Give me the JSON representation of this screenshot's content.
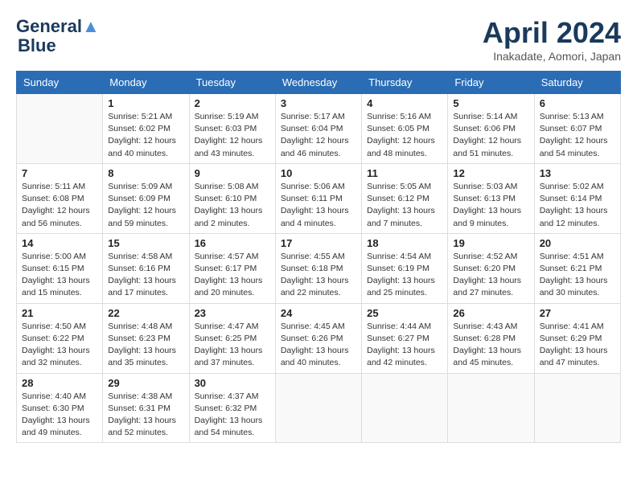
{
  "header": {
    "logo_line1": "General",
    "logo_line2": "Blue",
    "month_title": "April 2024",
    "location": "Inakadate, Aomori, Japan"
  },
  "days_of_week": [
    "Sunday",
    "Monday",
    "Tuesday",
    "Wednesday",
    "Thursday",
    "Friday",
    "Saturday"
  ],
  "weeks": [
    [
      {
        "day": "",
        "info": ""
      },
      {
        "day": "1",
        "info": "Sunrise: 5:21 AM\nSunset: 6:02 PM\nDaylight: 12 hours\nand 40 minutes."
      },
      {
        "day": "2",
        "info": "Sunrise: 5:19 AM\nSunset: 6:03 PM\nDaylight: 12 hours\nand 43 minutes."
      },
      {
        "day": "3",
        "info": "Sunrise: 5:17 AM\nSunset: 6:04 PM\nDaylight: 12 hours\nand 46 minutes."
      },
      {
        "day": "4",
        "info": "Sunrise: 5:16 AM\nSunset: 6:05 PM\nDaylight: 12 hours\nand 48 minutes."
      },
      {
        "day": "5",
        "info": "Sunrise: 5:14 AM\nSunset: 6:06 PM\nDaylight: 12 hours\nand 51 minutes."
      },
      {
        "day": "6",
        "info": "Sunrise: 5:13 AM\nSunset: 6:07 PM\nDaylight: 12 hours\nand 54 minutes."
      }
    ],
    [
      {
        "day": "7",
        "info": "Sunrise: 5:11 AM\nSunset: 6:08 PM\nDaylight: 12 hours\nand 56 minutes."
      },
      {
        "day": "8",
        "info": "Sunrise: 5:09 AM\nSunset: 6:09 PM\nDaylight: 12 hours\nand 59 minutes."
      },
      {
        "day": "9",
        "info": "Sunrise: 5:08 AM\nSunset: 6:10 PM\nDaylight: 13 hours\nand 2 minutes."
      },
      {
        "day": "10",
        "info": "Sunrise: 5:06 AM\nSunset: 6:11 PM\nDaylight: 13 hours\nand 4 minutes."
      },
      {
        "day": "11",
        "info": "Sunrise: 5:05 AM\nSunset: 6:12 PM\nDaylight: 13 hours\nand 7 minutes."
      },
      {
        "day": "12",
        "info": "Sunrise: 5:03 AM\nSunset: 6:13 PM\nDaylight: 13 hours\nand 9 minutes."
      },
      {
        "day": "13",
        "info": "Sunrise: 5:02 AM\nSunset: 6:14 PM\nDaylight: 13 hours\nand 12 minutes."
      }
    ],
    [
      {
        "day": "14",
        "info": "Sunrise: 5:00 AM\nSunset: 6:15 PM\nDaylight: 13 hours\nand 15 minutes."
      },
      {
        "day": "15",
        "info": "Sunrise: 4:58 AM\nSunset: 6:16 PM\nDaylight: 13 hours\nand 17 minutes."
      },
      {
        "day": "16",
        "info": "Sunrise: 4:57 AM\nSunset: 6:17 PM\nDaylight: 13 hours\nand 20 minutes."
      },
      {
        "day": "17",
        "info": "Sunrise: 4:55 AM\nSunset: 6:18 PM\nDaylight: 13 hours\nand 22 minutes."
      },
      {
        "day": "18",
        "info": "Sunrise: 4:54 AM\nSunset: 6:19 PM\nDaylight: 13 hours\nand 25 minutes."
      },
      {
        "day": "19",
        "info": "Sunrise: 4:52 AM\nSunset: 6:20 PM\nDaylight: 13 hours\nand 27 minutes."
      },
      {
        "day": "20",
        "info": "Sunrise: 4:51 AM\nSunset: 6:21 PM\nDaylight: 13 hours\nand 30 minutes."
      }
    ],
    [
      {
        "day": "21",
        "info": "Sunrise: 4:50 AM\nSunset: 6:22 PM\nDaylight: 13 hours\nand 32 minutes."
      },
      {
        "day": "22",
        "info": "Sunrise: 4:48 AM\nSunset: 6:23 PM\nDaylight: 13 hours\nand 35 minutes."
      },
      {
        "day": "23",
        "info": "Sunrise: 4:47 AM\nSunset: 6:25 PM\nDaylight: 13 hours\nand 37 minutes."
      },
      {
        "day": "24",
        "info": "Sunrise: 4:45 AM\nSunset: 6:26 PM\nDaylight: 13 hours\nand 40 minutes."
      },
      {
        "day": "25",
        "info": "Sunrise: 4:44 AM\nSunset: 6:27 PM\nDaylight: 13 hours\nand 42 minutes."
      },
      {
        "day": "26",
        "info": "Sunrise: 4:43 AM\nSunset: 6:28 PM\nDaylight: 13 hours\nand 45 minutes."
      },
      {
        "day": "27",
        "info": "Sunrise: 4:41 AM\nSunset: 6:29 PM\nDaylight: 13 hours\nand 47 minutes."
      }
    ],
    [
      {
        "day": "28",
        "info": "Sunrise: 4:40 AM\nSunset: 6:30 PM\nDaylight: 13 hours\nand 49 minutes."
      },
      {
        "day": "29",
        "info": "Sunrise: 4:38 AM\nSunset: 6:31 PM\nDaylight: 13 hours\nand 52 minutes."
      },
      {
        "day": "30",
        "info": "Sunrise: 4:37 AM\nSunset: 6:32 PM\nDaylight: 13 hours\nand 54 minutes."
      },
      {
        "day": "",
        "info": ""
      },
      {
        "day": "",
        "info": ""
      },
      {
        "day": "",
        "info": ""
      },
      {
        "day": "",
        "info": ""
      }
    ]
  ]
}
